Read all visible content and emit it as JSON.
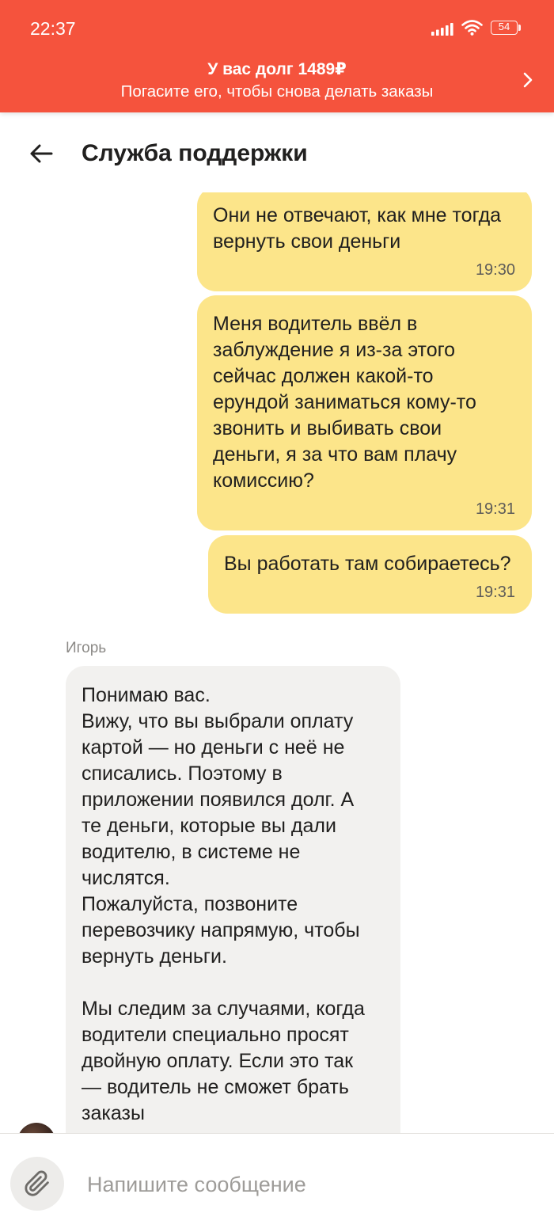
{
  "status_bar": {
    "time": "22:37",
    "battery_level": "54",
    "icons": [
      "signal-icon",
      "wifi-icon",
      "battery-icon"
    ]
  },
  "debt_banner": {
    "title": "У вас долг 1489₽",
    "subtitle": "Погасите его, чтобы снова делать заказы",
    "icon": "chevron-right-icon"
  },
  "header": {
    "title": "Служба поддержки",
    "back_icon": "arrow-left-icon"
  },
  "chat": {
    "messages": [
      {
        "lines": [
          "Они не отвечают, как мне тогда",
          "вернуть свои деньги"
        ],
        "time": "19:30"
      },
      {
        "lines": [
          "Меня водитель ввёл в",
          "заблуждение я из-за этого",
          "сейчас должен какой-то",
          "ерундой заниматься кому-то",
          "звонить и выбивать свои",
          "деньги, я за что вам плачу",
          "комиссию?"
        ],
        "time": "19:31"
      },
      {
        "lines": [
          "Вы работать там собираетесь?"
        ],
        "time": "19:31"
      },
      {
        "author": "Игорь",
        "paragraphs": [
          [
            "Понимаю вас.",
            "Вижу, что вы выбрали оплату",
            "картой — но деньги с неё не",
            "списались. Поэтому в",
            "приложении появился долг. А",
            "те деньги, которые вы дали",
            "водителю, в системе не",
            "числятся.",
            "Пожалуйста, позвоните",
            "перевозчику напрямую, чтобы",
            "вернуть деньги."
          ],
          [
            "Мы следим за случаями, когда",
            "водители специально просят",
            "двойную оплату. Если это так",
            "— водитель не сможет брать",
            "заказы"
          ]
        ]
      }
    ]
  },
  "composer": {
    "placeholder": "Напишите сообщение",
    "attach_icon": "paperclip-icon"
  },
  "colors": {
    "banner_background": "#F5533D",
    "outgoing_bubble": "#FCE58A",
    "incoming_bubble": "#F2F1EF",
    "text": "#21201F",
    "secondary_text": "#8C8A87"
  }
}
